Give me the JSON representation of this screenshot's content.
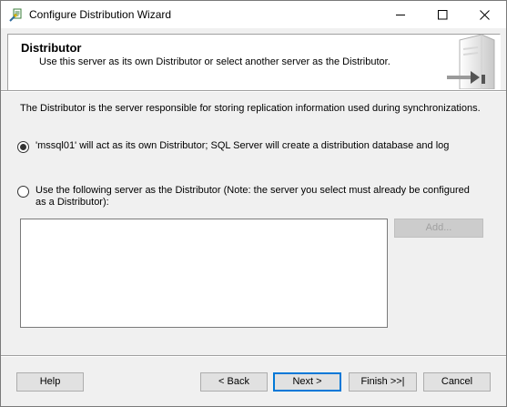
{
  "window": {
    "title": "Configure Distribution Wizard",
    "icon": "wizard-icon"
  },
  "header": {
    "title": "Distributor",
    "subtitle": "Use this server as its own Distributor or select another server as the Distributor.",
    "art_icon": "server-icon"
  },
  "main": {
    "description": "The Distributor is the server responsible for storing replication information used during synchronizations.",
    "option_own": {
      "label": "'mssql01' will act as its own Distributor; SQL Server will create a distribution database and log",
      "selected": true
    },
    "option_other": {
      "label": "Use the following server as the Distributor (Note: the server you select must already be configured as a Distributor):",
      "selected": false
    },
    "server_list": [],
    "add_label": "Add..."
  },
  "footer": {
    "help_label": "Help",
    "back_label": "< Back",
    "next_label": "Next >",
    "finish_label": "Finish >>|",
    "cancel_label": "Cancel"
  },
  "colors": {
    "focus_border": "#0078d7",
    "window_bg": "#f0f0f0",
    "button_bg": "#e1e1e1"
  }
}
